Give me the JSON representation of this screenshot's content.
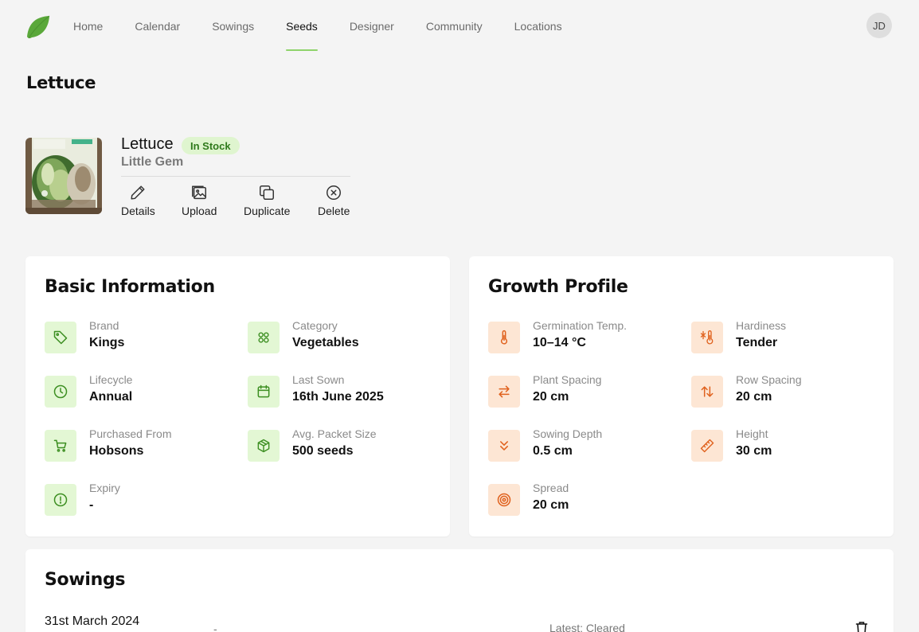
{
  "nav": {
    "items": [
      {
        "label": "Home"
      },
      {
        "label": "Calendar"
      },
      {
        "label": "Sowings"
      },
      {
        "label": "Seeds",
        "active": true
      },
      {
        "label": "Designer"
      },
      {
        "label": "Community"
      },
      {
        "label": "Locations"
      }
    ],
    "avatar_initials": "JD"
  },
  "page": {
    "title": "Lettuce"
  },
  "seed": {
    "name": "Lettuce",
    "variety": "Little Gem",
    "stock_badge": "In Stock",
    "actions": {
      "details": "Details",
      "upload": "Upload",
      "duplicate": "Duplicate",
      "delete": "Delete"
    }
  },
  "basic_info": {
    "title": "Basic Information",
    "brand": {
      "label": "Brand",
      "value": "Kings",
      "icon": "tag-icon"
    },
    "category": {
      "label": "Category",
      "value": "Vegetables",
      "icon": "category-icon"
    },
    "lifecycle": {
      "label": "Lifecycle",
      "value": "Annual",
      "icon": "clock-icon"
    },
    "last_sown": {
      "label": "Last Sown",
      "value": "16th June 2025",
      "icon": "calendar-icon"
    },
    "purchased_from": {
      "label": "Purchased From",
      "value": "Hobsons",
      "icon": "cart-icon"
    },
    "packet_size": {
      "label": "Avg. Packet Size",
      "value": "500 seeds",
      "icon": "box-icon"
    },
    "expiry": {
      "label": "Expiry",
      "value": "-",
      "icon": "alert-circle-icon"
    }
  },
  "growth_profile": {
    "title": "Growth Profile",
    "germination_temp": {
      "label": "Germination Temp.",
      "value": "10–14 °C",
      "icon": "thermometer-icon"
    },
    "hardiness": {
      "label": "Hardiness",
      "value": "Tender",
      "icon": "frost-icon"
    },
    "plant_spacing": {
      "label": "Plant Spacing",
      "value": "20 cm",
      "icon": "horizontal-arrows-icon"
    },
    "row_spacing": {
      "label": "Row Spacing",
      "value": "20 cm",
      "icon": "vertical-arrows-icon"
    },
    "sowing_depth": {
      "label": "Sowing Depth",
      "value": "0.5 cm",
      "icon": "chevrons-down-icon"
    },
    "height": {
      "label": "Height",
      "value": "30 cm",
      "icon": "ruler-icon"
    },
    "spread": {
      "label": "Spread",
      "value": "20 cm",
      "icon": "target-icon"
    }
  },
  "sowings": {
    "title": "Sowings",
    "rows": [
      {
        "date": "31st March 2024",
        "location": "-",
        "status": "Latest: Cleared"
      }
    ]
  },
  "colors": {
    "accent_green": "#8fd36b",
    "badge_bg": "#dff5cf",
    "icon_green_bg": "#e3f7d4",
    "icon_orange_bg": "#fde6d4",
    "icon_orange": "#e0621e"
  }
}
